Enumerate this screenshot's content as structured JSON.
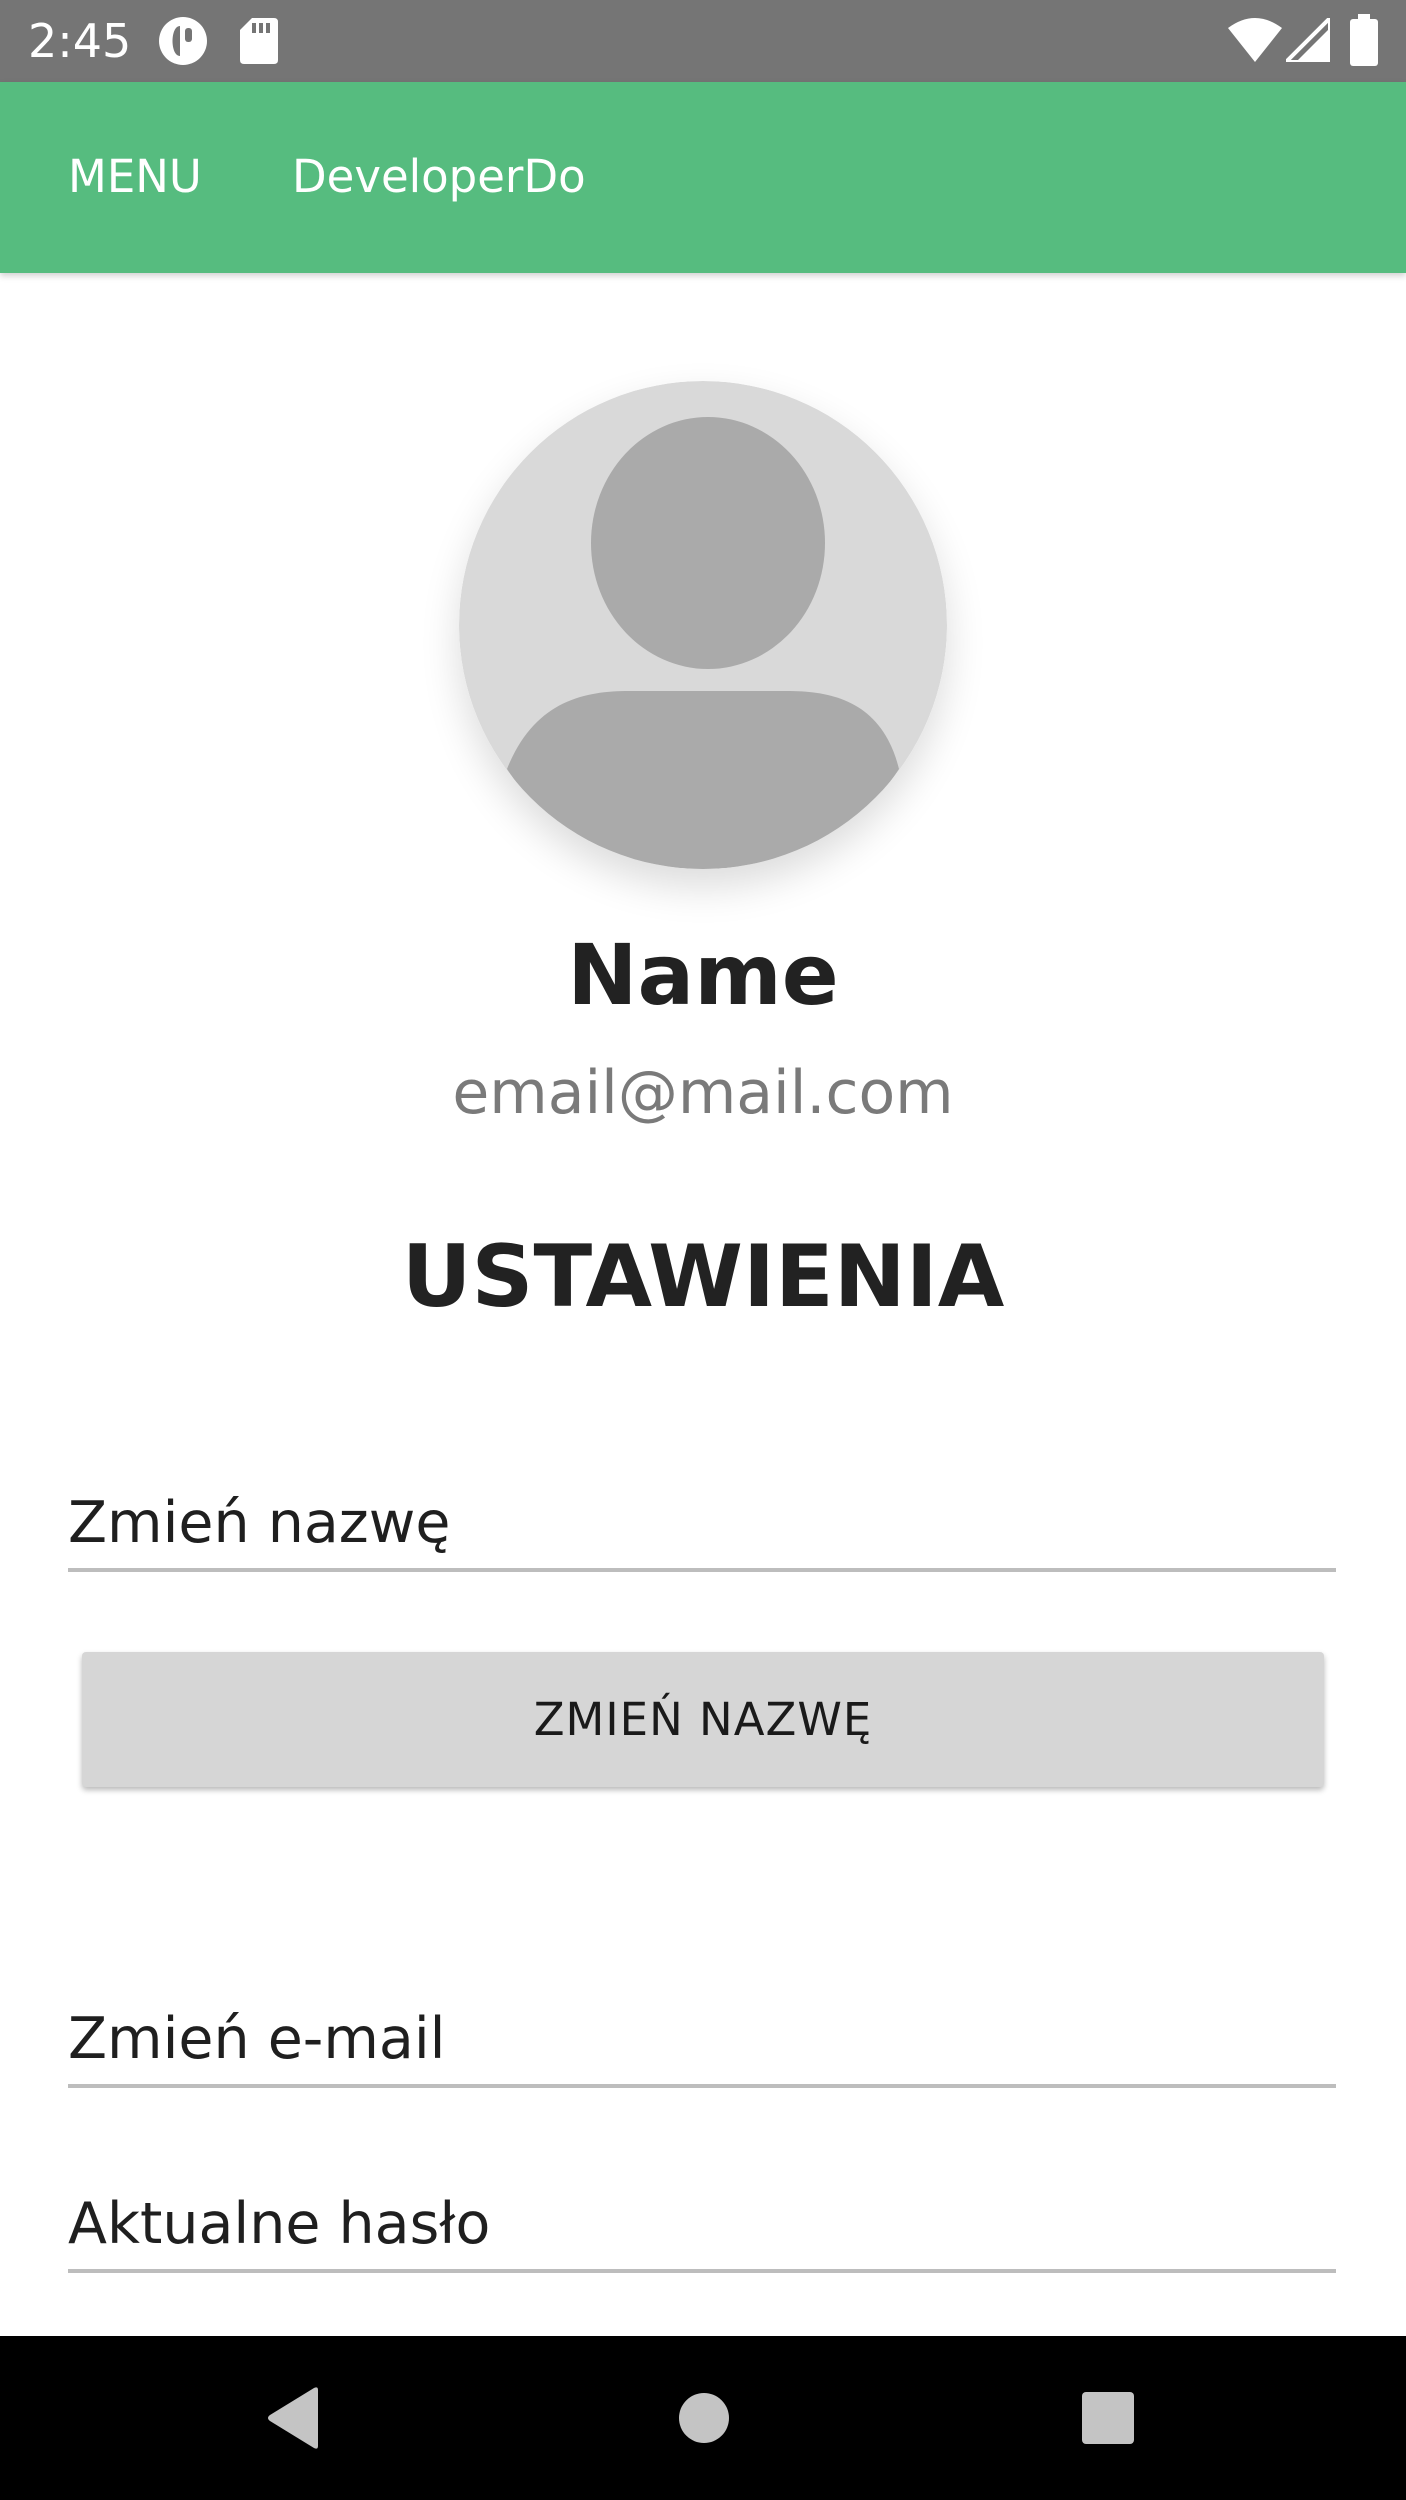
{
  "status_bar": {
    "time": "2:45",
    "icons": [
      "notification-app-icon",
      "sd-card-icon",
      "wifi-icon",
      "cell-signal-icon",
      "battery-icon"
    ]
  },
  "app_bar": {
    "menu_label": "MENU",
    "title": "DeveloperDo",
    "color": "#56bc7f"
  },
  "profile": {
    "name": "Name",
    "email": "email@mail.com",
    "avatar_icon": "default-avatar-icon"
  },
  "settings": {
    "title": "USTAWIENIA",
    "name_field_placeholder": "Zmień nazwę",
    "name_button_label": "ZMIEŃ NAZWĘ",
    "email_field_placeholder": "Zmień e-mail",
    "password_field_placeholder": "Aktualne hasło"
  },
  "nav_bar": {
    "icons": [
      "back-icon",
      "home-icon",
      "recents-icon"
    ]
  }
}
